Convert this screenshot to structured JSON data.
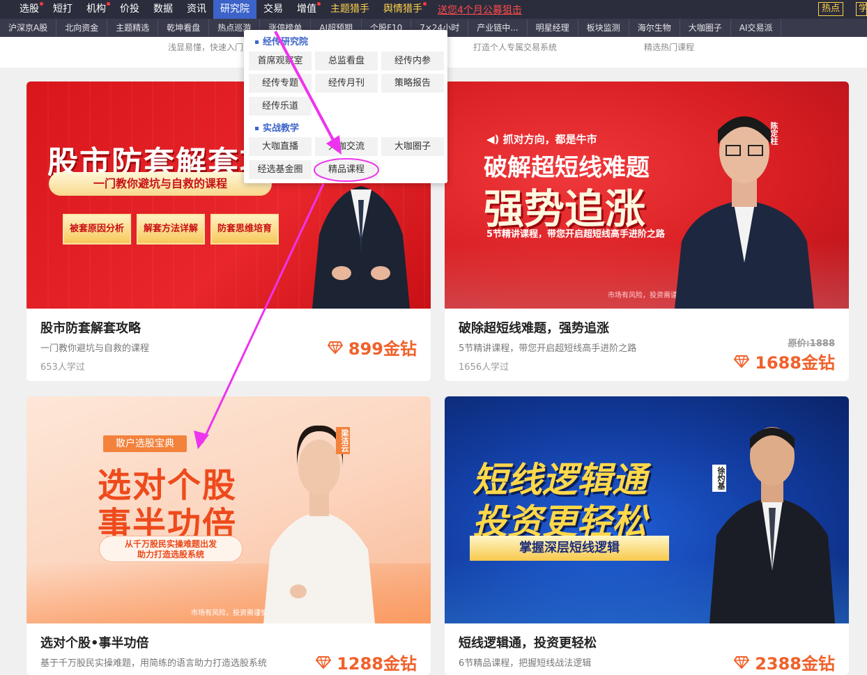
{
  "topnav": {
    "items": [
      {
        "label": "选股",
        "dot": true
      },
      {
        "label": "短打",
        "dot": false
      },
      {
        "label": "机构",
        "dot": true
      },
      {
        "label": "价投",
        "dot": false
      },
      {
        "label": "数据",
        "dot": false
      },
      {
        "label": "资讯",
        "dot": false
      },
      {
        "label": "研究院",
        "dot": false,
        "active": true
      },
      {
        "label": "交易",
        "dot": false
      },
      {
        "label": "增值",
        "dot": true
      },
      {
        "label": "主题猎手",
        "dot": false,
        "yellow": true
      },
      {
        "label": "舆情猎手",
        "dot": true,
        "yellow": true
      }
    ],
    "promo": "送您4个月公募狙击",
    "hot": "热点",
    "hot2": "学"
  },
  "subnav": {
    "items": [
      "沪深京A股",
      "北向资金",
      "主题精选",
      "乾坤看盘",
      "热点巡游",
      "涨停榜单",
      "AI超预期",
      "个股F10",
      "7×24小时",
      "产业链中...",
      "明星经理",
      "板块监测",
      "海尔生物",
      "大咖圈子",
      "AI交易派"
    ]
  },
  "hintbar": {
    "texts": [
      "浅显易懂，快速入门",
      "打造个人专属交易系统",
      "精选热门课程"
    ]
  },
  "dropdown": {
    "section1": "经传研究院",
    "section1_items": [
      "首席观察室",
      "总监看盘",
      "经传内参",
      "经传专题",
      "经传月刊",
      "策略报告",
      "经传乐道"
    ],
    "section2": "实战教学",
    "section2_items": [
      "大咖直播",
      "大咖交流",
      "大咖圈子",
      "经选基金圈",
      "精品课程"
    ]
  },
  "cards": [
    {
      "title": "股市防套解套攻略",
      "desc": "一门教你避坑与自救的课程",
      "learners": "653人学过",
      "price": "899金钻",
      "banner": {
        "headline": "股市防套解套攻",
        "sub": "一门教你避坑与自救的课程",
        "tags": [
          "被套原因分析",
          "解套方法详解",
          "防套思维培育"
        ]
      }
    },
    {
      "title": "破除超短线难题，强势追涨",
      "desc": "5节精讲课程，带您开启超短线高手进阶之路",
      "learners": "1656人学过",
      "orig": "原价:1888",
      "price": "1688金钻",
      "banner": {
        "tag": "抓对方向，都是牛市",
        "headline1": "破解超短线难题",
        "headline2": "强势追涨",
        "sub": "5节精讲课程，带您开启超短线高手进阶之路",
        "risk": "市场有风险，投资需谨慎",
        "teacher": "陈定柱"
      }
    },
    {
      "title": "选对个股•事半功倍",
      "desc": "基于千万股民实操难题，用简练的语言助力打造选股系统",
      "price": "1288金钻",
      "banner": {
        "tag": "散户选股宝典",
        "headline1": "选对个股",
        "headline2": "事半功倍",
        "sub1": "从千万股民实操难题出发",
        "sub2": "助力打造选股系统",
        "risk": "市场有风险，投资需谨慎",
        "teacher": "梁洁云"
      }
    },
    {
      "title": "短线逻辑通，投资更轻松",
      "desc": "6节精品课程，把握短线战法逻辑",
      "price": "2388金钻",
      "banner": {
        "headline1": "短线逻辑通",
        "headline2": "投资更轻松",
        "sub": "掌握深层短线逻辑",
        "teacher": "徐灼基"
      }
    }
  ],
  "colors": {
    "nav_bg": "#2b2d3d",
    "active": "#3c63c9",
    "price": "#f0612b",
    "annotation": "#ee33ee"
  }
}
